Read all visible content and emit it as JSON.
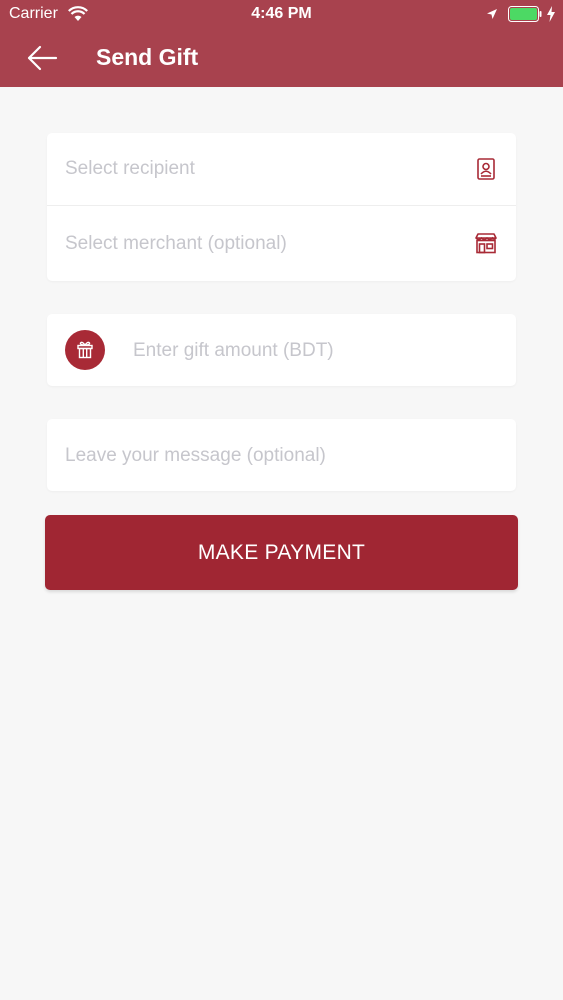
{
  "status_bar": {
    "carrier": "Carrier",
    "time": "4:46 PM"
  },
  "header": {
    "title": "Send Gift",
    "background_color": "#a8424e"
  },
  "form": {
    "recipient_placeholder": "Select recipient",
    "merchant_placeholder": "Select merchant (optional)",
    "amount_placeholder": "Enter gift amount (BDT)",
    "message_placeholder": "Leave your message (optional)",
    "recipient_icon": "contact-book-icon",
    "merchant_icon": "storefront-icon",
    "amount_icon": "gift-icon"
  },
  "actions": {
    "pay_label": "MAKE PAYMENT",
    "pay_color": "#a02633"
  }
}
